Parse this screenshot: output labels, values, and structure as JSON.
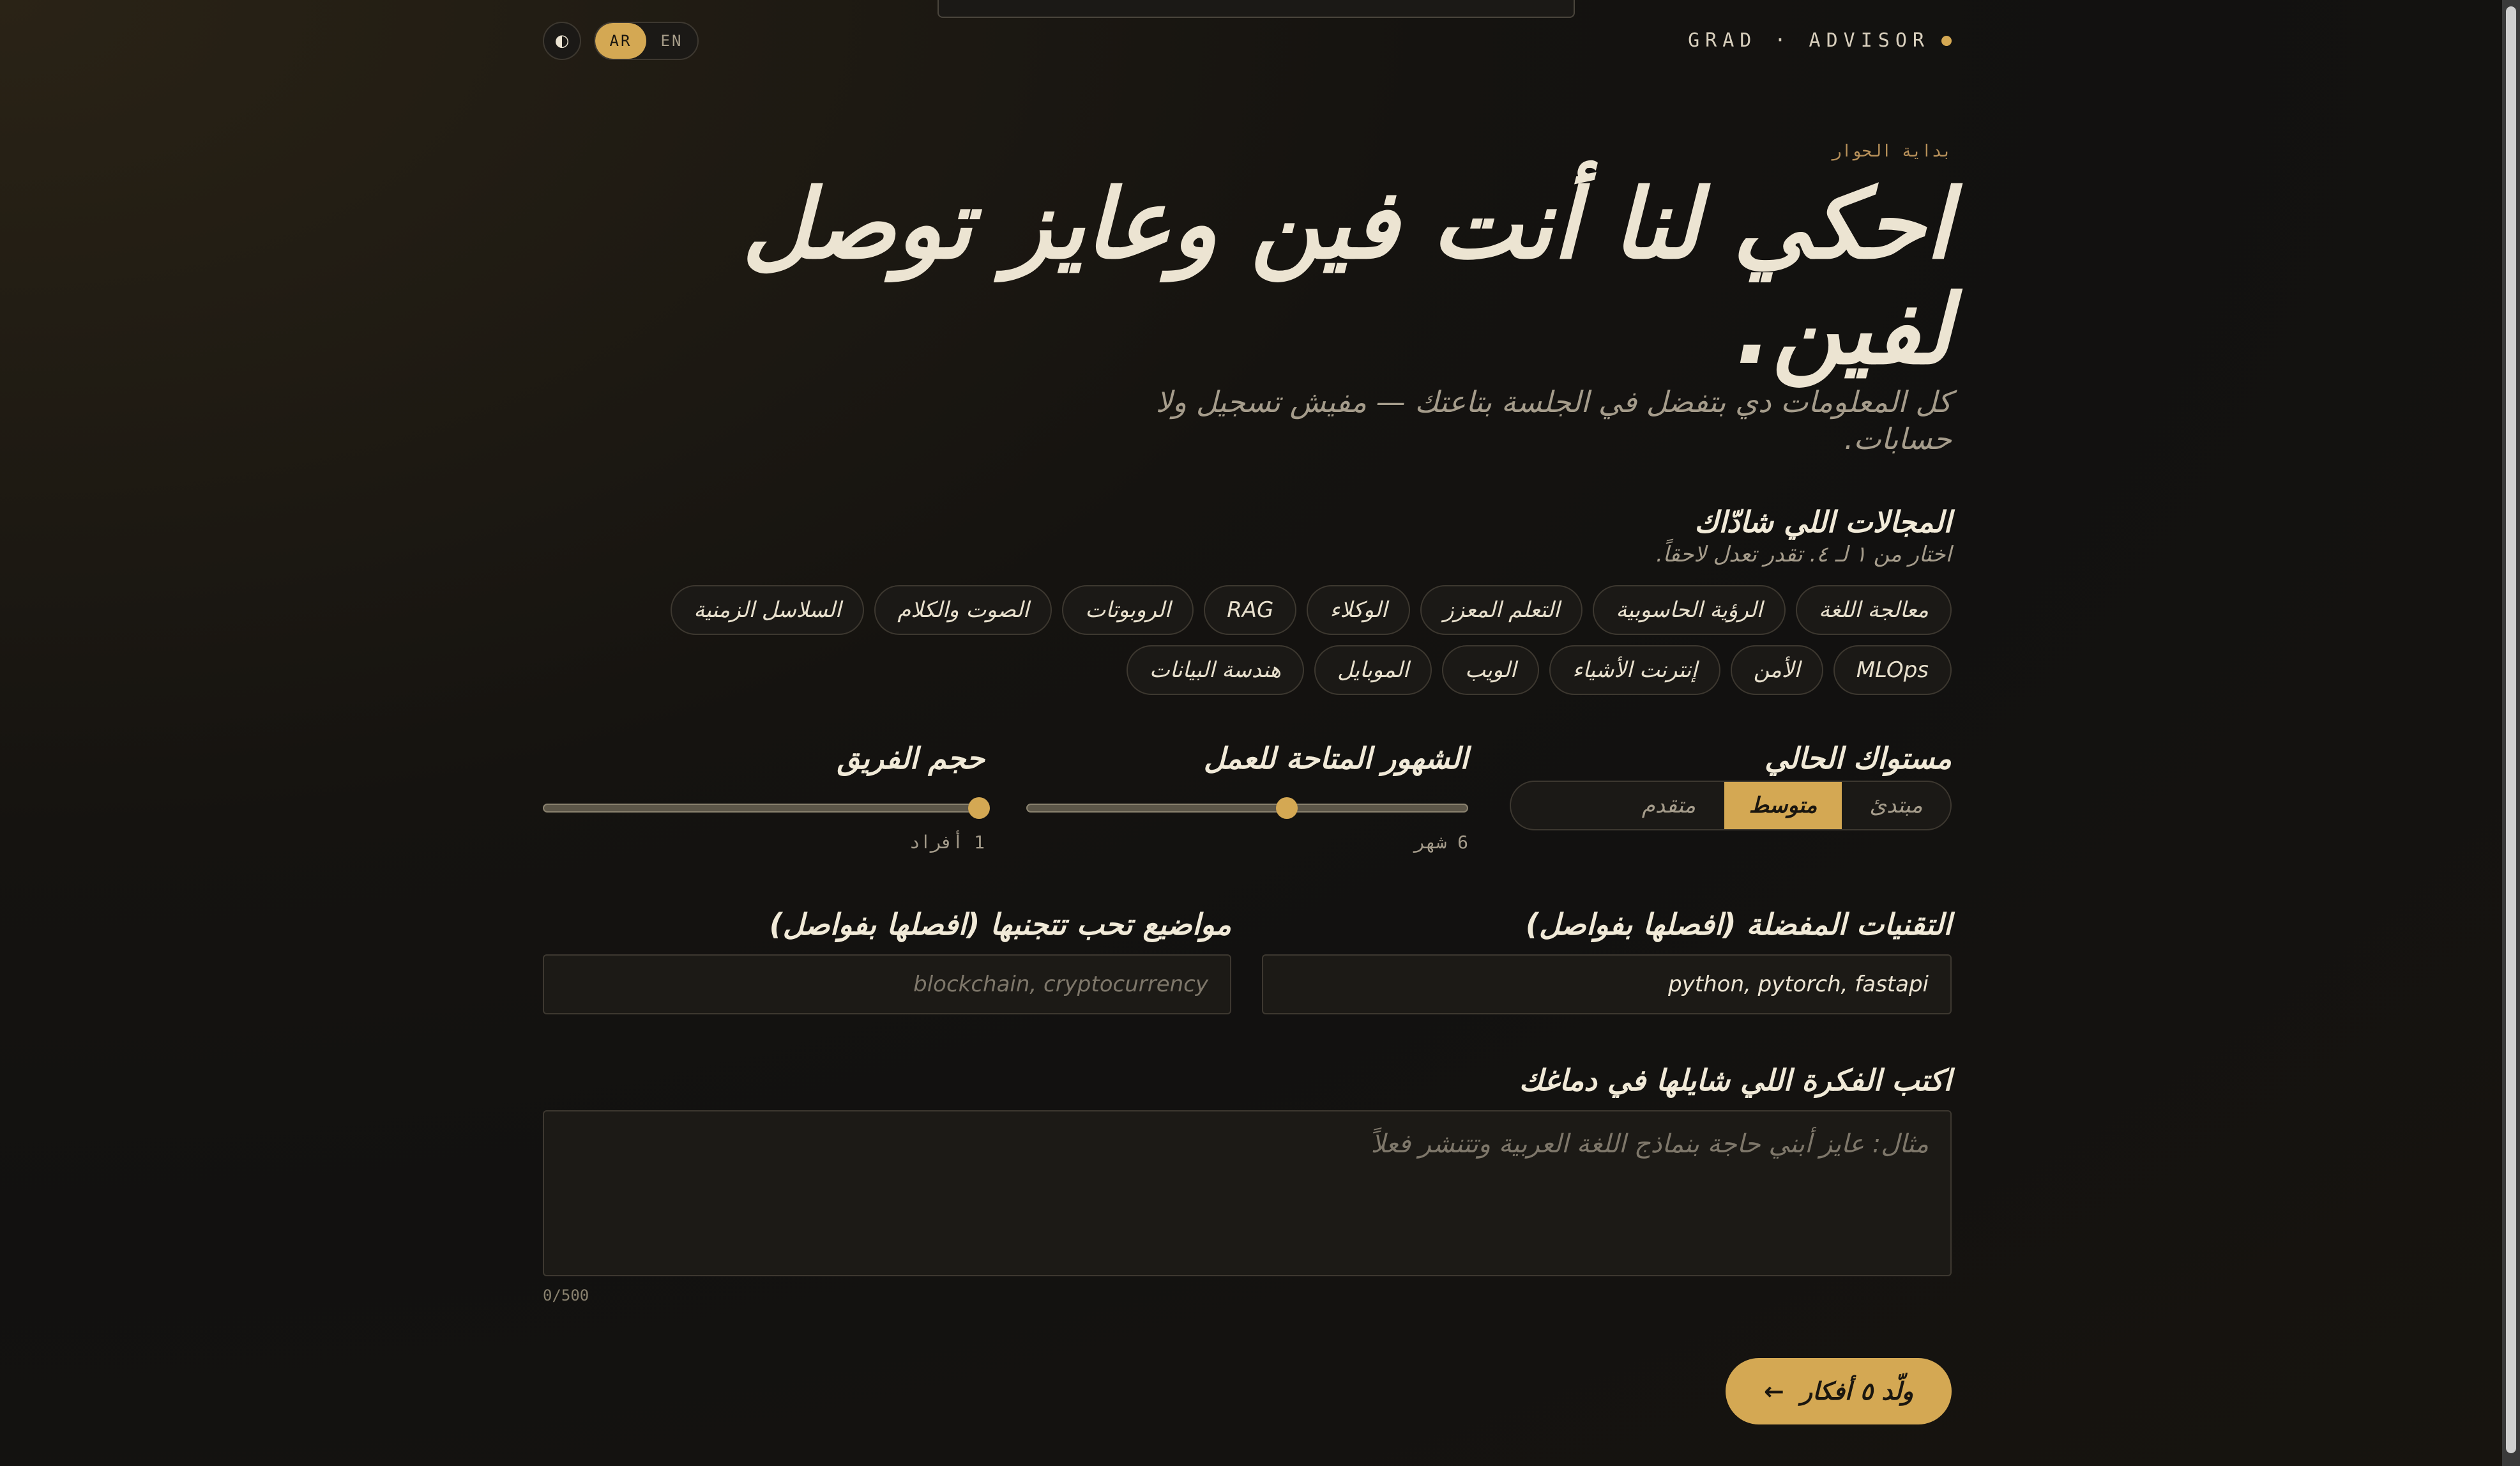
{
  "header": {
    "brand": "GRAD · ADVISOR",
    "theme_icon": "half-circle-icon",
    "languages": [
      {
        "code": "AR",
        "active": true
      },
      {
        "code": "EN",
        "active": false
      }
    ]
  },
  "hero": {
    "eyebrow": "بداية الحوار",
    "title": "احكي لنا أنت فين وعايز توصل لفين.",
    "subtitle": "كل المعلومات دي بتفضل في الجلسة بتاعتك — مفيش تسجيل ولا حسابات."
  },
  "interests": {
    "title": "المجالات اللي شادّاك",
    "hint": "اختار من ١ لـ ٤. تقدر تعدل لاحقاً.",
    "chips": [
      "معالجة اللغة",
      "الرؤية الحاسوبية",
      "التعلم المعزز",
      "الوكلاء",
      "RAG",
      "الروبوتات",
      "الصوت والكلام",
      "السلاسل الزمنية",
      "MLOps",
      "الأمن",
      "إنترنت الأشياء",
      "الويب",
      "الموبايل",
      "هندسة البيانات"
    ]
  },
  "level": {
    "title": "مستواك الحالي",
    "options": [
      "مبتدئ",
      "متوسط",
      "متقدم"
    ],
    "selected": "متوسط"
  },
  "months": {
    "title": "الشهور المتاحة للعمل",
    "value_label": "6 شهر",
    "value": 6,
    "fraction": 0.59
  },
  "team": {
    "title": "حجم الفريق",
    "value_label": "1 أفراد",
    "value": 1,
    "fraction": 0.99
  },
  "preferred_tech": {
    "title": "التقنيات المفضلة (افصلها بفواصل)",
    "value": "python, pytorch, fastapi"
  },
  "avoid_topics": {
    "title": "مواضيع تحب تتجنبها (افصلها بفواصل)",
    "placeholder": "blockchain, cryptocurrency"
  },
  "idea": {
    "title": "اكتب الفكرة اللي شايلها في دماغك",
    "placeholder": "مثال: عايز أبني حاجة بنماذج اللغة العربية وتتنشر فعلاً",
    "counter": "0/500"
  },
  "submit": {
    "label": "ولّد ٥ أفكار",
    "arrow": "←"
  },
  "colors": {
    "accent": "#d4a853",
    "background": "#151310",
    "text": "#ece4d2"
  }
}
